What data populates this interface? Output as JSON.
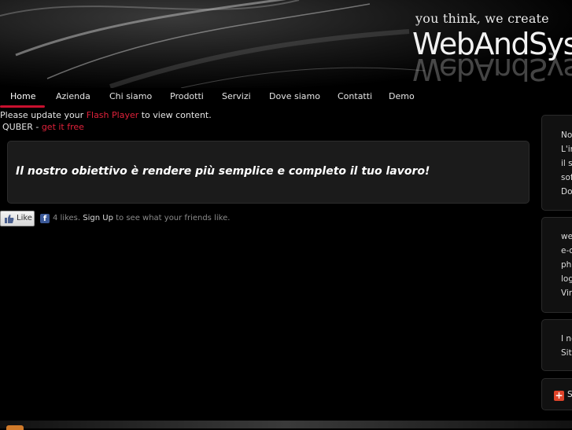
{
  "header": {
    "tagline": "you think, we create",
    "logo": "WebAndSys"
  },
  "nav": {
    "items": [
      {
        "label": "Home",
        "active": true
      },
      {
        "label": "Azienda"
      },
      {
        "label": "Chi siamo"
      },
      {
        "label": "Prodotti"
      },
      {
        "label": "Servizi"
      },
      {
        "label": "Dove siamo"
      },
      {
        "label": "Contatti"
      },
      {
        "label": "Demo"
      }
    ],
    "active_color": "#c8102e"
  },
  "flash_notice": {
    "before": "Please update your ",
    "link": "Flash Player",
    "after": " to view content."
  },
  "quber": {
    "label": "QUBER - ",
    "link": "get it free"
  },
  "main": {
    "headline": "Il nostro obiettivo è rendere più semplice e completo il tuo lavoro!"
  },
  "like_bar": {
    "button_label": "Like",
    "count_text": "4 likes.",
    "signup": "Sign Up",
    "suffix": " to see what your friends like."
  },
  "sidebar": {
    "box1": [
      "No",
      "L'in",
      "il s",
      "sof",
      "Do"
    ],
    "box2": [
      "we",
      "e-c",
      "phe",
      "log",
      "Vir"
    ],
    "box3": [
      "I no",
      "Sit"
    ],
    "box4": [
      "S"
    ]
  }
}
